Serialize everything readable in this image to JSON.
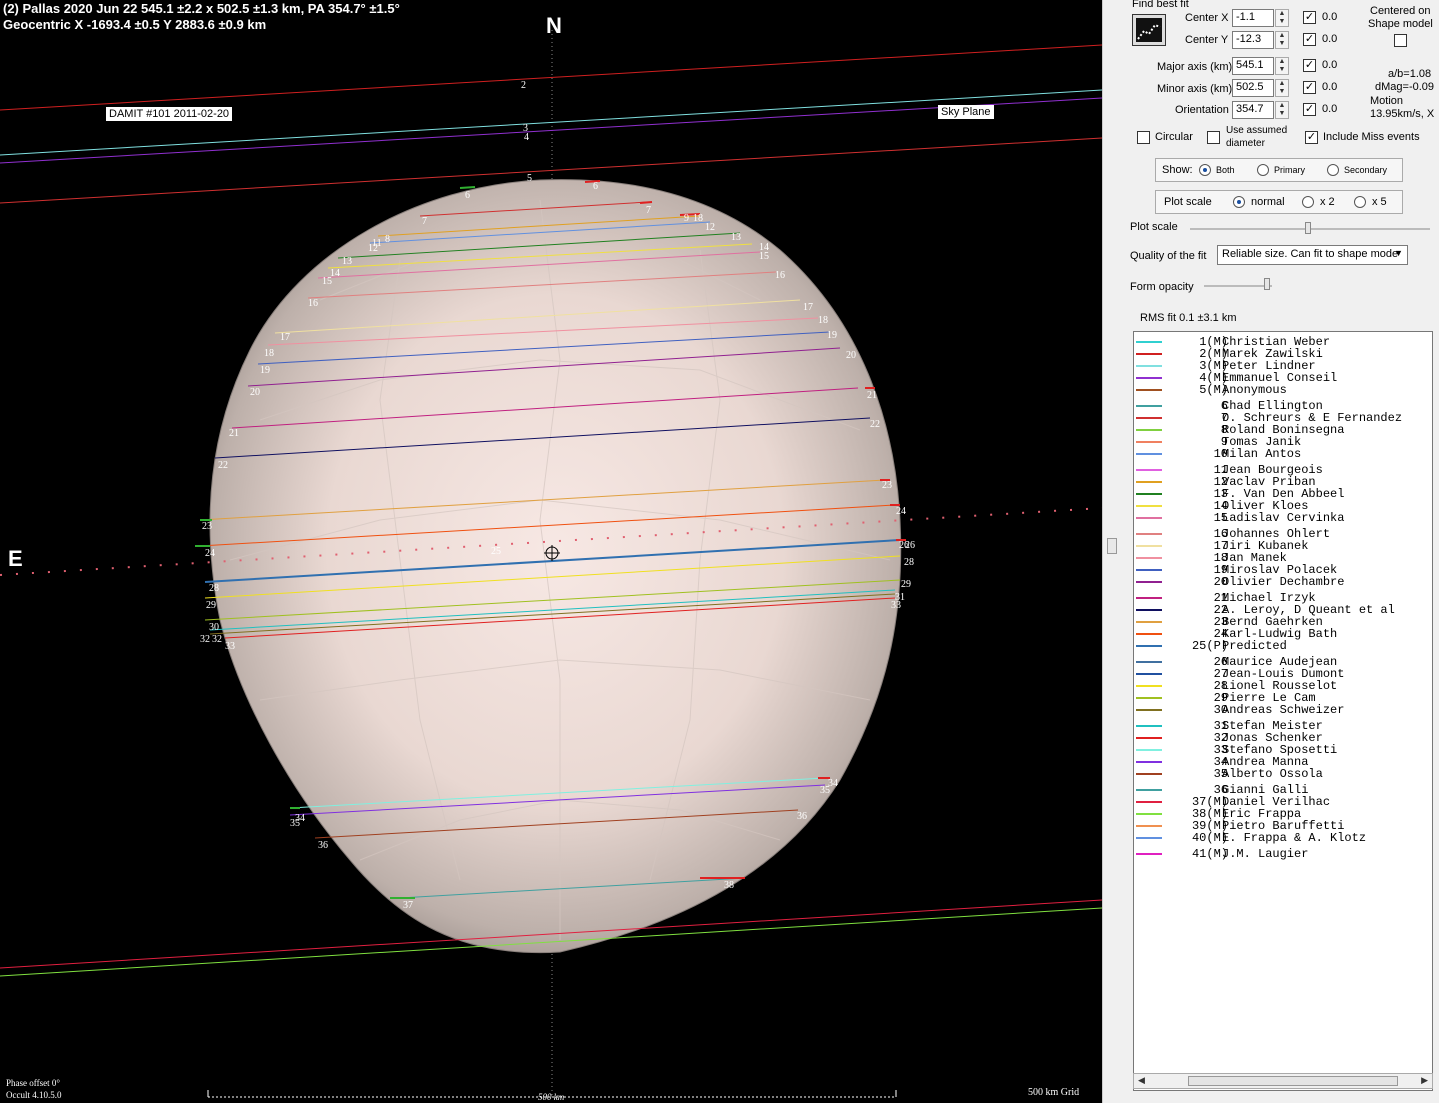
{
  "header": {
    "line1": "(2) Pallas  2020 Jun 22   545.1 ±2.2 x 502.5 ±1.3 km, PA 354.7° ±1.5°",
    "line2": "Geocentric X  -1693.4 ±0.5  Y 2883.6 ±0.9 km"
  },
  "plot": {
    "north_label": "N",
    "east_label": "E",
    "damit_label": "DAMIT #101 2011-02-20",
    "sky_plane_label": "Sky Plane",
    "phase_offset": "Phase offset 0°",
    "version": "Occult 4.10.5.0",
    "grid_label": "500 km Grid",
    "scale_label": "500 km",
    "chord_labels": [
      "2",
      "3",
      "4",
      "5",
      "6",
      "6",
      "7",
      "7",
      "9",
      "1",
      "8",
      "12",
      "12",
      "11",
      "8",
      "13",
      "13",
      "14",
      "14",
      "15",
      "15",
      "16",
      "16",
      "17",
      "17",
      "18",
      "18",
      "19",
      "19",
      "20",
      "20",
      "21",
      "21",
      "22",
      "22",
      "23",
      "23",
      "24",
      "24",
      "25",
      "26",
      "26",
      "28",
      "28",
      "29",
      "29",
      "30",
      "31",
      "32",
      "32",
      "33",
      "33",
      "34",
      "34",
      "35",
      "35",
      "36",
      "36",
      "37",
      "38"
    ],
    "colors": {
      "shape_fill": "#e9d9d4",
      "background": "#000000"
    }
  },
  "panel": {
    "find_best_fit_label": "Find best fit",
    "find_best_fit_icon": "best-fit-chart-icon",
    "centered_label": "Centered on",
    "shape_model_label": "Shape model",
    "center_x_label": "Center X",
    "center_x_value": "-1.1",
    "center_x_check": "0.0",
    "center_y_label": "Center Y",
    "center_y_value": "-12.3",
    "center_y_check": "0.0",
    "major_label": "Major axis (km)",
    "major_value": "545.1",
    "major_check": "0.0",
    "minor_label": "Minor axis (km)",
    "minor_value": "502.5",
    "minor_check": "0.0",
    "orient_label": "Orientation",
    "orient_value": "354.7",
    "orient_check": "0.0",
    "ab_ratio": "a/b=1.08",
    "dmag": "dMag=-0.09",
    "motion_label": "Motion",
    "motion_value": "13.95km/s, X",
    "circular_label": "Circular",
    "assumed_label_1": "Use assumed",
    "assumed_label_2": "diameter",
    "miss_label": "Include Miss events",
    "show_label": "Show:",
    "show_both": "Both",
    "show_primary": "Primary",
    "show_secondary": "Secondary",
    "plotscale_group_label": "Plot scale",
    "scale_normal": "normal",
    "scale_x2": "x 2",
    "scale_x5": "x 5",
    "plotscale_slider_label": "Plot scale",
    "quality_label": "Quality of the fit",
    "quality_value": "Reliable size. Can fit to shape mode",
    "opacity_label": "Form opacity",
    "rms_label": "RMS fit 0.1 ±3.1 km"
  },
  "observers": [
    {
      "num": "1(M)",
      "name": "Christian Weber",
      "color": "#30d0d0"
    },
    {
      "num": "2(M)",
      "name": "Marek Zawilski",
      "color": "#d02020"
    },
    {
      "num": "3(M)",
      "name": "Peter Lindner",
      "color": "#80e0e0"
    },
    {
      "num": "4(M)",
      "name": "Emmanuel Conseil",
      "color": "#9030d0"
    },
    {
      "num": "5(M)",
      "name": "Anonymous",
      "color": "#a05020"
    },
    {
      "num": "6",
      "name": "Chad Ellington",
      "color": "#40a0a0"
    },
    {
      "num": "7",
      "name": "O. Schreurs & E Fernandez",
      "color": "#d03030"
    },
    {
      "num": "8",
      "name": "Roland Boninsegna",
      "color": "#80d040"
    },
    {
      "num": "9",
      "name": "Tomas Janik",
      "color": "#f08060"
    },
    {
      "num": "10",
      "name": "Milan Antos",
      "color": "#6090e0"
    },
    {
      "num": "11",
      "name": "Jean Bourgeois",
      "color": "#e060e0"
    },
    {
      "num": "12",
      "name": "Vaclav Priban",
      "color": "#e0a020"
    },
    {
      "num": "13",
      "name": "F. Van Den Abbeel",
      "color": "#208020"
    },
    {
      "num": "14",
      "name": "Oliver Kloes",
      "color": "#f0e040"
    },
    {
      "num": "15",
      "name": "Ladislav Cervinka",
      "color": "#e070a0"
    },
    {
      "num": "16",
      "name": "Johannes Ohlert",
      "color": "#e08080"
    },
    {
      "num": "17",
      "name": "Jiri Kubanek",
      "color": "#f0e0a0"
    },
    {
      "num": "18",
      "name": "Jan Manek",
      "color": "#f090a0"
    },
    {
      "num": "19",
      "name": "Miroslav Polacek",
      "color": "#4060c0"
    },
    {
      "num": "20",
      "name": "Olivier Dechambre",
      "color": "#902090"
    },
    {
      "num": "21",
      "name": "Michael Irzyk",
      "color": "#c02080"
    },
    {
      "num": "22",
      "name": "A. Leroy, D Queant et al",
      "color": "#101060"
    },
    {
      "num": "23",
      "name": "Bernd Gaehrken",
      "color": "#e0a040"
    },
    {
      "num": "24",
      "name": "Karl-Ludwig Bath",
      "color": "#f05010"
    },
    {
      "num": "25(P)",
      "name": "Predicted",
      "color": "#3070b0"
    },
    {
      "num": "26",
      "name": "Maurice Audejean",
      "color": "#4070a0"
    },
    {
      "num": "27",
      "name": "Jean-Louis Dumont",
      "color": "#2050a0"
    },
    {
      "num": "28",
      "name": "Lionel Rousselot",
      "color": "#f0e020"
    },
    {
      "num": "29",
      "name": "Pierre Le Cam",
      "color": "#a0c020"
    },
    {
      "num": "30",
      "name": "Andreas Schweizer",
      "color": "#807020"
    },
    {
      "num": "31",
      "name": "Stefan Meister",
      "color": "#20c0c0"
    },
    {
      "num": "32",
      "name": "Jonas Schenker",
      "color": "#e02020"
    },
    {
      "num": "33",
      "name": "Stefano Sposetti",
      "color": "#80f0e0"
    },
    {
      "num": "34",
      "name": "Andrea Manna",
      "color": "#8030e0"
    },
    {
      "num": "35",
      "name": "Alberto Ossola",
      "color": "#a04020"
    },
    {
      "num": "36",
      "name": "Gianni Galli",
      "color": "#40a0a0"
    },
    {
      "num": "37(M)",
      "name": "Daniel Verilhac",
      "color": "#e02040"
    },
    {
      "num": "38(M)",
      "name": "Eric Frappa",
      "color": "#80e040"
    },
    {
      "num": "39(M)",
      "name": "Pietro Baruffetti",
      "color": "#f09050"
    },
    {
      "num": "40(M)",
      "name": "E. Frappa & A. Klotz",
      "color": "#6090e0"
    },
    {
      "num": "41(M)",
      "name": "J.M. Laugier",
      "color": "#e020c0"
    }
  ]
}
